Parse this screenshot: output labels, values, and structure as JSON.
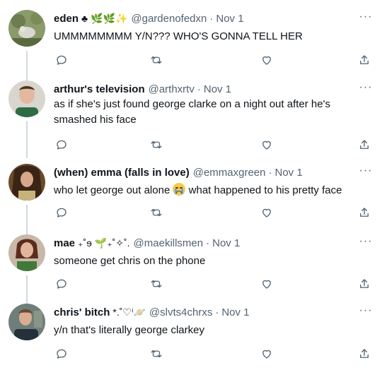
{
  "tweets": [
    {
      "name": "eden",
      "decoration": "♣ 🌿🌿✨",
      "handle": "@gardenofedxn",
      "time": "Nov 1",
      "text": "UMMMMMMMM Y/N??? WHO'S GONNA TELL HER"
    },
    {
      "name": "arthur's television",
      "decoration": "",
      "handle": "@arthxrtv",
      "time": "Nov 1",
      "text": "as if she's just found george clarke on a night out after he's smashed his face"
    },
    {
      "name": "(when) emma (falls in love)",
      "decoration": "",
      "handle": "@emmaxgreen",
      "time": "Nov 1",
      "text_before": "who let george out alone",
      "emoji": "loudly-crying-face",
      "text_after": "what happened to his pretty face"
    },
    {
      "name": "mae",
      "decoration": "₊˚ɘ 🌱₊˚✧˚.",
      "handle": "@maekillsmen",
      "time": "Nov 1",
      "text": "someone get chris on the phone"
    },
    {
      "name": "chris' bitch",
      "decoration": "*.˚♡ⁱ🪐",
      "handle": "@slvts4chrxs",
      "time": "Nov 1",
      "text": "y/n that's literally george clarkey"
    }
  ],
  "common": {
    "separator": "·",
    "more": "···"
  },
  "colors": {
    "text": "#0f1419",
    "secondary": "#536471",
    "thread_line": "#cfd9de"
  }
}
